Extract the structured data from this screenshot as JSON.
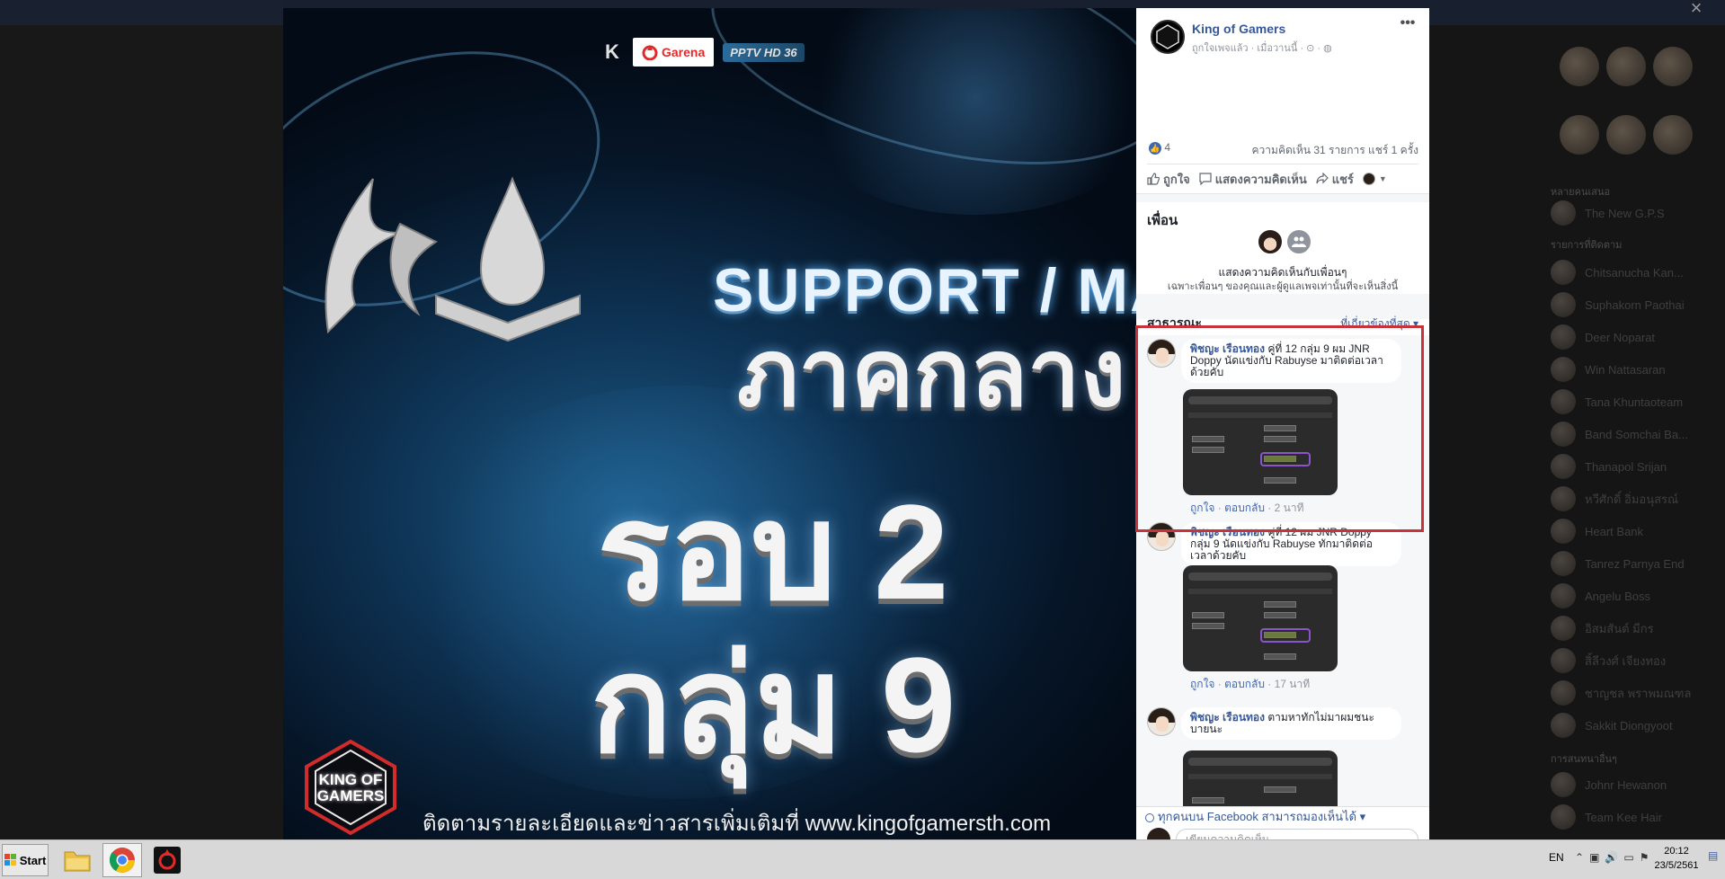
{
  "close_label": "×",
  "post": {
    "page_name": "King of Gamers",
    "meta": "ถูกใจเพจแล้ว · เมื่อวานนี้ · ⊙ · ◍",
    "more": "•••",
    "like_count": "4",
    "counts": "ความคิดเห็น 31 รายการ  แชร์ 1 ครั้ง",
    "actions": {
      "like": "ถูกใจ",
      "comment": "แสดงความคิดเห็น",
      "share": "แชร์"
    }
  },
  "friends": {
    "title": "เพื่อน",
    "line1": "แสดงความคิดเห็นกับเพื่อนๆ",
    "line2": "เฉพาะเพื่อนๆ ของคุณและผู้ดูแลเพจเท่านั้นที่จะเห็นสิ่งนี้"
  },
  "public": {
    "label": "สาธารณะ",
    "sort": "ที่เกี่ยวข้องที่สุด ▾"
  },
  "comments": [
    {
      "author": "พิชญะ เรือนทอง",
      "text": " คู่ที่ 12 กลุ่ม 9 ผม JNR Doppy นัดแข่งกับ Rabuyse มาติดต่อเวลาด้วยคับ",
      "like": "ถูกใจ",
      "reply": "ตอบกลับ",
      "time": "2 นาที"
    },
    {
      "author": "พิชญะ เรือนทอง",
      "text": " คู่ที่ 12 ผม JNR Doppy กลุ่ม 9 นัดแข่งกับ Rabuyse ทักมาติดต่อเวลาด้วยคับ",
      "like": "ถูกใจ",
      "reply": "ตอบกลับ",
      "time": "17 นาที"
    },
    {
      "author": "พิชญะ เรือนทอง",
      "text": " ตามหาทักไม่มาผมชนะบายนะ"
    }
  ],
  "visibility": "ทุกคนบน Facebook สามารถมองเห็นได้ ▾",
  "comment_placeholder": "เขียนความคิดเห็น...",
  "poster": {
    "support": "SUPPORT / MAGE",
    "region": "ภาคกลาง",
    "round": "รอบ 2",
    "group": "กลุ่ม 9",
    "garena": "Garena",
    "k_logo": "K",
    "pptv": "PPTV HD 36",
    "kog_logo": "KING OF GAMERS",
    "footer": "ติดตามรายละเอียดและข่าวสารเพิ่มเติมที่ www.kingofgamersth.com"
  },
  "background": {
    "heads": [
      "หลายคนเสนอ",
      "รายการที่ติดตาม",
      "การสนทนาอื่นๆ"
    ],
    "contacts": [
      "The New G.P.S",
      "Chitsanucha Kan...",
      "Suphakorn Paothai",
      "Deer Noparat",
      "Win Nattasaran",
      "Tana Khuntaoteam",
      "Band Somchai Ba...",
      "Thanapol Srijan",
      "หวีศักดิ์ อิ่มอนุสรณ์",
      "Heart Bank",
      "Tanrez Parnya End",
      "Angelu Boss",
      "อิสมสันต์ มีกร",
      "สิ้ลีวงศ์ เจียงทอง",
      "ชาญชล พราพมณฑล",
      "Sakkit Diongyoot",
      "Johnr Hewanon",
      "Team Kee Hair"
    ]
  },
  "taskbar": {
    "start": "Start",
    "lang": "EN",
    "time": "20:12",
    "date": "23/5/2561"
  }
}
